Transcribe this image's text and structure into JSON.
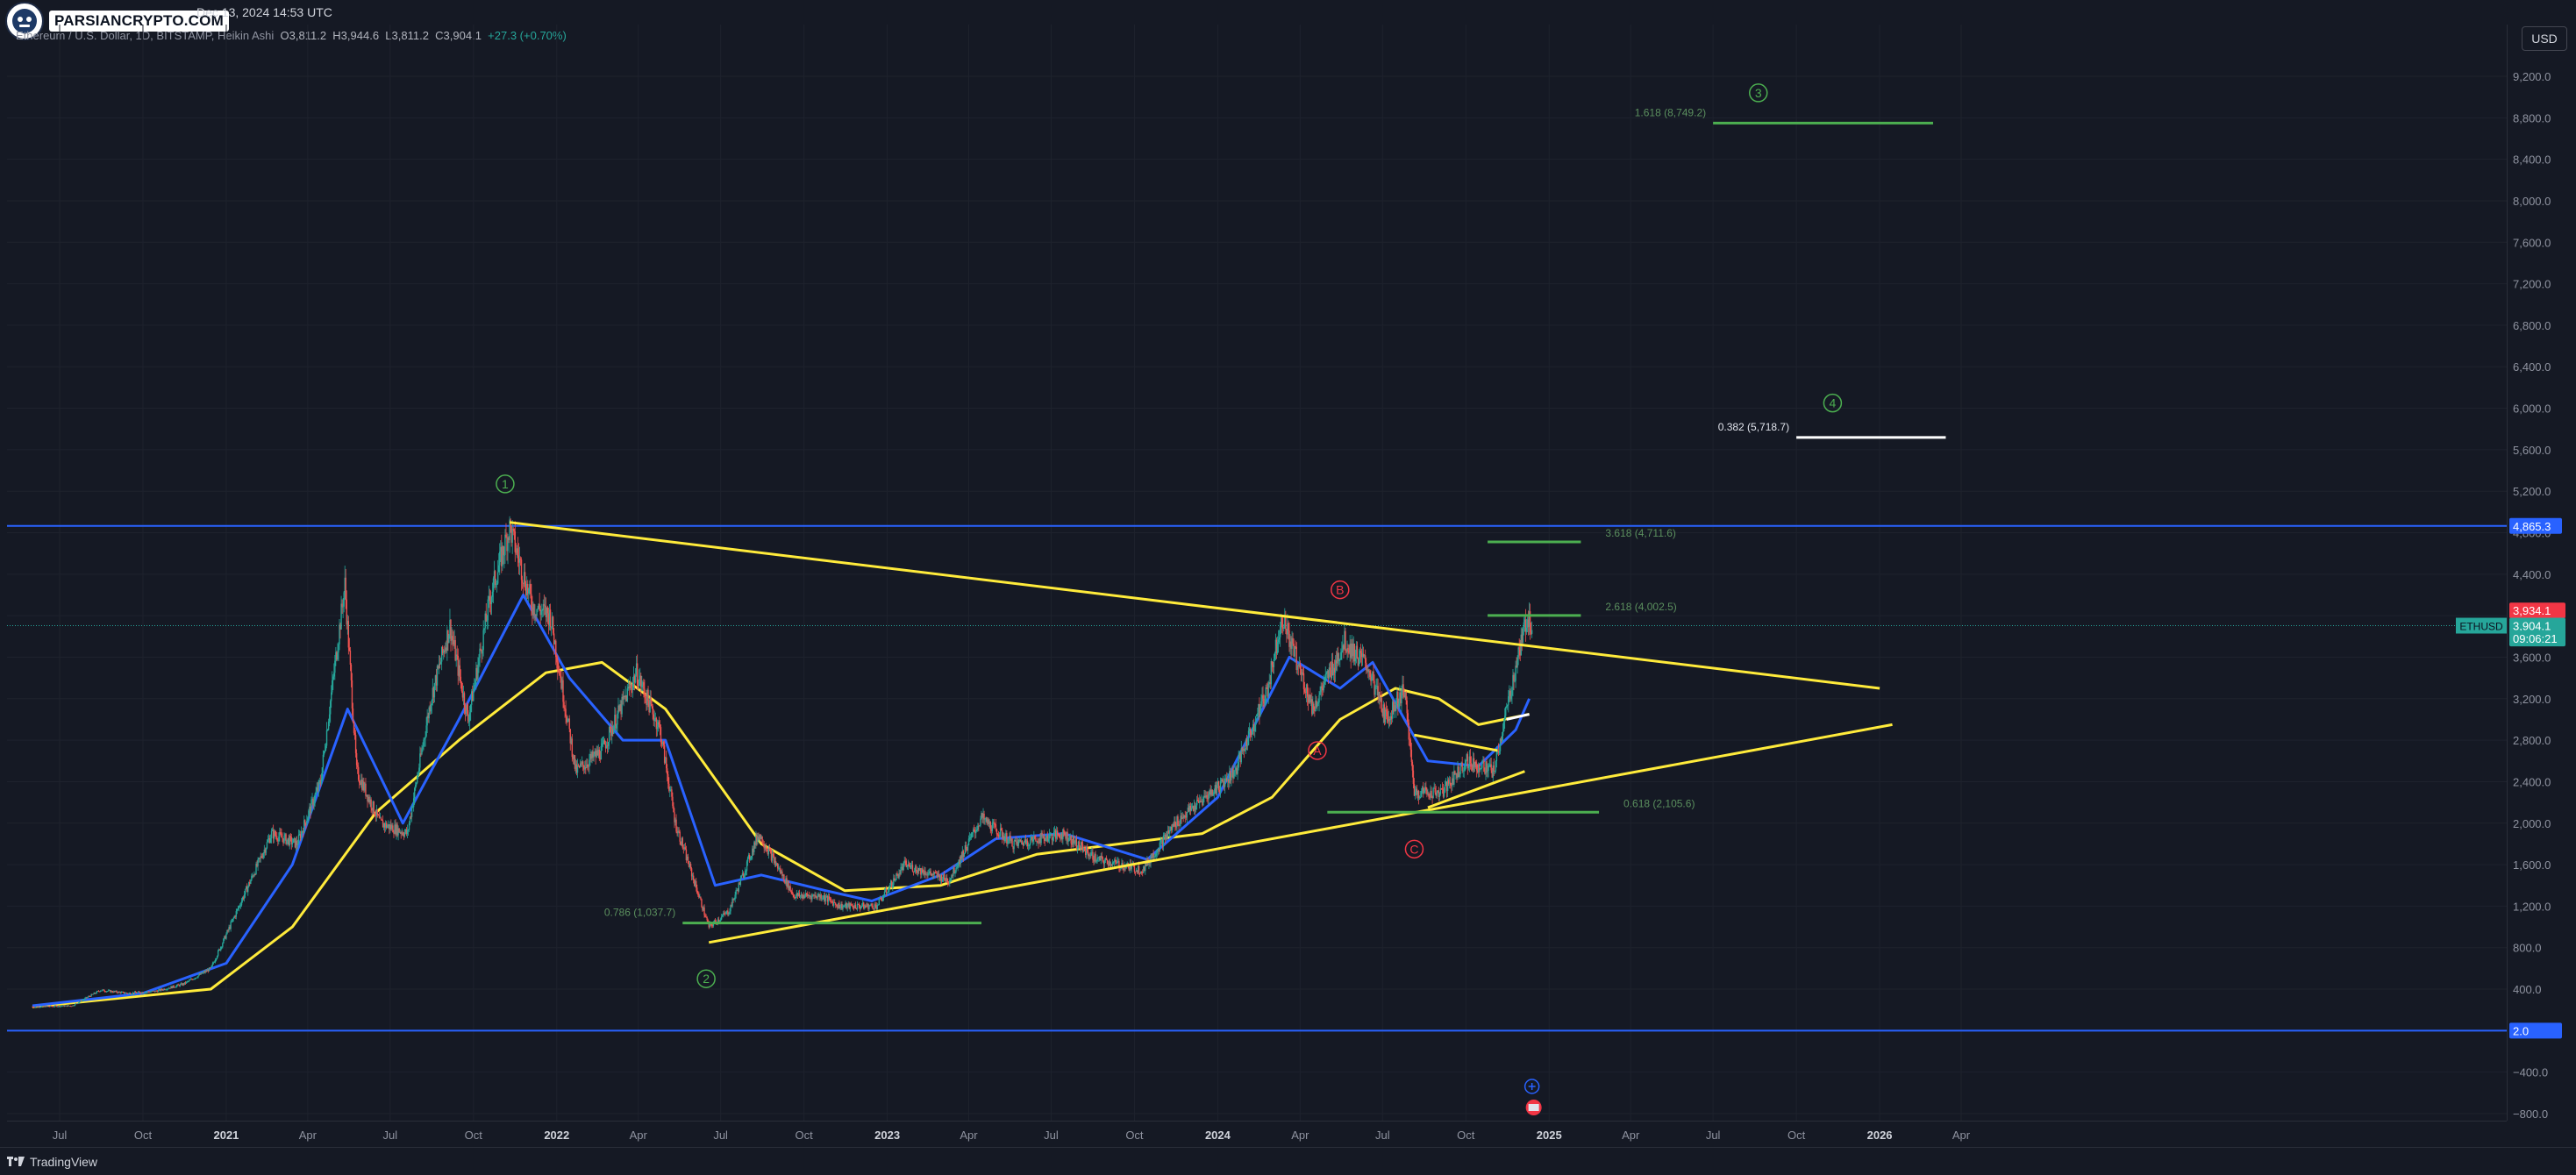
{
  "header": {
    "brand": "PARSIANCRYPTO.COM",
    "date": "Dec 13, 2024 14:53 UTC",
    "symbol_desc": "Ethereum / U.S. Dollar, 1D, BITSTAMP, Heikin Ashi",
    "ohlc": {
      "open": "O3,811.2",
      "high": "H3,944.6",
      "low": "L3,811.2",
      "close": "C3,904.1",
      "change": "+27.3 (+0.70%)"
    },
    "currency": "USD"
  },
  "footer": {
    "brand": "TradingView"
  },
  "chart_data": {
    "type": "candlestick",
    "symbol": "ETHUSD",
    "x_axis_labels": [
      "Jul",
      "Oct",
      "2021",
      "Apr",
      "Jul",
      "Oct",
      "2022",
      "Apr",
      "Jul",
      "Oct",
      "2023",
      "Apr",
      "Jul",
      "Oct",
      "2024",
      "Apr",
      "Jul",
      "Oct",
      "2025",
      "Apr",
      "Jul",
      "Oct",
      "2026",
      "Apr"
    ],
    "x_axis_dates": [
      "2020-07-01",
      "2020-10-01",
      "2021-01-01",
      "2021-04-01",
      "2021-07-01",
      "2021-10-01",
      "2022-01-01",
      "2022-04-01",
      "2022-07-01",
      "2022-10-01",
      "2023-01-01",
      "2023-04-01",
      "2023-07-01",
      "2023-10-01",
      "2024-01-01",
      "2024-04-01",
      "2024-07-01",
      "2024-10-01",
      "2025-01-01",
      "2025-04-01",
      "2025-07-01",
      "2025-10-01",
      "2026-01-01",
      "2026-04-01"
    ],
    "y_axis_labels": [
      "9,200.0",
      "8,800.0",
      "8,400.0",
      "8,000.0",
      "7,600.0",
      "7,200.0",
      "6,800.0",
      "6,400.0",
      "6,000.0",
      "5,600.0",
      "5,200.0",
      "4,800.0",
      "4,400.0",
      "4,000.0",
      "3,600.0",
      "3,200.0",
      "2,800.0",
      "2,400.0",
      "2,000.0",
      "1,600.0",
      "1,200.0",
      "800.0",
      "400.0",
      "0.0",
      "−400.0",
      "−800.0"
    ],
    "y_axis_values": [
      9200,
      8800,
      8400,
      8000,
      7600,
      7200,
      6800,
      6400,
      6000,
      5600,
      5200,
      4800,
      4400,
      4000,
      3600,
      3200,
      2800,
      2400,
      2000,
      1600,
      1200,
      800,
      400,
      0,
      -400,
      -800
    ],
    "ylim": [
      -800,
      9200
    ],
    "price_path": [
      [
        "2020-06-01",
        230
      ],
      [
        "2020-07-15",
        240
      ],
      [
        "2020-08-15",
        390
      ],
      [
        "2020-09-15",
        360
      ],
      [
        "2020-10-15",
        380
      ],
      [
        "2020-11-15",
        450
      ],
      [
        "2020-12-15",
        600
      ],
      [
        "2021-01-10",
        1100
      ],
      [
        "2021-02-20",
        1900
      ],
      [
        "2021-03-20",
        1800
      ],
      [
        "2021-04-15",
        2400
      ],
      [
        "2021-05-12",
        4300
      ],
      [
        "2021-05-25",
        2500
      ],
      [
        "2021-06-20",
        2000
      ],
      [
        "2021-07-20",
        1900
      ],
      [
        "2021-08-15",
        3200
      ],
      [
        "2021-09-05",
        3900
      ],
      [
        "2021-09-25",
        3000
      ],
      [
        "2021-10-20",
        4200
      ],
      [
        "2021-11-10",
        4850
      ],
      [
        "2021-12-05",
        4100
      ],
      [
        "2021-12-25",
        4000
      ],
      [
        "2022-01-22",
        2500
      ],
      [
        "2022-02-20",
        2700
      ],
      [
        "2022-03-30",
        3450
      ],
      [
        "2022-04-25",
        2900
      ],
      [
        "2022-05-12",
        2000
      ],
      [
        "2022-06-18",
        1000
      ],
      [
        "2022-07-10",
        1150
      ],
      [
        "2022-08-12",
        1900
      ],
      [
        "2022-09-20",
        1300
      ],
      [
        "2022-10-20",
        1300
      ],
      [
        "2022-11-10",
        1200
      ],
      [
        "2022-12-20",
        1200
      ],
      [
        "2023-01-20",
        1600
      ],
      [
        "2023-03-10",
        1450
      ],
      [
        "2023-04-15",
        2050
      ],
      [
        "2023-05-20",
        1800
      ],
      [
        "2023-07-15",
        1900
      ],
      [
        "2023-08-20",
        1650
      ],
      [
        "2023-10-10",
        1550
      ],
      [
        "2023-11-15",
        2000
      ],
      [
        "2023-12-25",
        2300
      ],
      [
        "2024-01-20",
        2500
      ],
      [
        "2024-02-25",
        3300
      ],
      [
        "2024-03-12",
        4000
      ],
      [
        "2024-04-15",
        3100
      ],
      [
        "2024-05-20",
        3750
      ],
      [
        "2024-06-15",
        3500
      ],
      [
        "2024-07-05",
        3000
      ],
      [
        "2024-07-25",
        3300
      ],
      [
        "2024-08-05",
        2300
      ],
      [
        "2024-09-06",
        2300
      ],
      [
        "2024-10-01",
        2600
      ],
      [
        "2024-11-01",
        2500
      ],
      [
        "2024-11-25",
        3500
      ],
      [
        "2024-12-08",
        4000
      ],
      [
        "2024-12-13",
        3904
      ]
    ],
    "ma_blue": [
      [
        "2020-06-01",
        240
      ],
      [
        "2020-10-01",
        360
      ],
      [
        "2021-01-01",
        650
      ],
      [
        "2021-03-15",
        1600
      ],
      [
        "2021-05-15",
        3100
      ],
      [
        "2021-07-15",
        2000
      ],
      [
        "2021-09-15",
        3000
      ],
      [
        "2021-11-25",
        4200
      ],
      [
        "2022-01-15",
        3400
      ],
      [
        "2022-03-15",
        2800
      ],
      [
        "2022-05-01",
        2800
      ],
      [
        "2022-06-25",
        1400
      ],
      [
        "2022-08-15",
        1500
      ],
      [
        "2022-10-25",
        1350
      ],
      [
        "2022-12-15",
        1250
      ],
      [
        "2023-03-01",
        1500
      ],
      [
        "2023-05-01",
        1850
      ],
      [
        "2023-07-15",
        1900
      ],
      [
        "2023-10-15",
        1650
      ],
      [
        "2024-01-01",
        2250
      ],
      [
        "2024-03-20",
        3600
      ],
      [
        "2024-05-15",
        3300
      ],
      [
        "2024-06-20",
        3550
      ],
      [
        "2024-08-20",
        2600
      ],
      [
        "2024-10-15",
        2550
      ],
      [
        "2024-11-25",
        2900
      ],
      [
        "2024-12-10",
        3200
      ]
    ],
    "ma_yellow": [
      [
        "2020-06-01",
        230
      ],
      [
        "2020-12-15",
        400
      ],
      [
        "2021-03-15",
        1000
      ],
      [
        "2021-06-15",
        2100
      ],
      [
        "2021-09-15",
        2800
      ],
      [
        "2021-12-20",
        3450
      ],
      [
        "2022-02-20",
        3550
      ],
      [
        "2022-05-01",
        3100
      ],
      [
        "2022-08-15",
        1800
      ],
      [
        "2022-11-15",
        1350
      ],
      [
        "2023-03-01",
        1400
      ],
      [
        "2023-06-15",
        1700
      ],
      [
        "2023-09-15",
        1800
      ],
      [
        "2023-12-15",
        1900
      ],
      [
        "2024-03-01",
        2250
      ],
      [
        "2024-05-15",
        3000
      ],
      [
        "2024-07-15",
        3300
      ],
      [
        "2024-09-01",
        3200
      ],
      [
        "2024-10-15",
        2950
      ],
      [
        "2024-12-10",
        3050
      ]
    ],
    "trendlines": [
      {
        "name": "upper-trendline",
        "color": "#ffeb3b",
        "points": [
          [
            "2021-11-10",
            4900
          ],
          [
            "2026-01-01",
            3300
          ]
        ]
      },
      {
        "name": "lower-trendline",
        "color": "#ffeb3b",
        "points": [
          [
            "2022-06-18",
            850
          ],
          [
            "2026-01-15",
            2950
          ]
        ]
      },
      {
        "name": "channel-top",
        "color": "#ffeb3b",
        "points": [
          [
            "2024-08-05",
            2850
          ],
          [
            "2024-11-05",
            2700
          ]
        ]
      },
      {
        "name": "channel-bottom",
        "color": "#ffeb3b",
        "points": [
          [
            "2024-08-20",
            2150
          ],
          [
            "2024-12-05",
            2500
          ]
        ]
      },
      {
        "name": "channel-mid",
        "color": "#ffffff",
        "points": [
          [
            "2024-11-15",
            3000
          ],
          [
            "2024-12-10",
            3050
          ]
        ]
      }
    ],
    "hlines": [
      {
        "name": "resistance-line",
        "color": "#2962ff",
        "value": 4865.3,
        "label": "4,865.3"
      },
      {
        "name": "zero-line",
        "color": "#2962ff",
        "value": 0,
        "label": "2.0"
      },
      {
        "name": "current-price-line",
        "color": "#26a69a",
        "value": 3904.1
      }
    ],
    "fib_levels": [
      {
        "name": "fib-1618",
        "label": "1.618 (8,749.2)",
        "value": 8749.2,
        "color": "#4caf50",
        "x_start": "2025-07-01",
        "x_end": "2026-03-01",
        "label_color": "#5b8f5e"
      },
      {
        "name": "fib-0382",
        "label": "0.382 (5,718.7)",
        "value": 5718.7,
        "color": "#ffffff",
        "x_start": "2025-10-01",
        "x_end": "2026-03-15",
        "label_color": "#e0e3eb"
      },
      {
        "name": "fib-3618",
        "label": "3.618 (4,711.6)",
        "value": 4711.6,
        "color": "#4caf50",
        "x_start": "2024-10-25",
        "x_end": "2025-02-05",
        "label_color": "#5b8f5e"
      },
      {
        "name": "fib-2618",
        "label": "2.618 (4,002.5)",
        "value": 4002.5,
        "color": "#4caf50",
        "x_start": "2024-10-25",
        "x_end": "2025-02-05",
        "label_color": "#5b8f5e"
      },
      {
        "name": "fib-0618",
        "label": "0.618 (2,105.6)",
        "value": 2105.6,
        "color": "#4caf50",
        "x_start": "2024-05-01",
        "x_end": "2025-02-25",
        "label_color": "#5b8f5e"
      },
      {
        "name": "fib-0786",
        "label": "0.786 (1,037.7)",
        "value": 1037.7,
        "color": "#4caf50",
        "x_start": "2022-05-20",
        "x_end": "2023-04-15",
        "label_color": "#5b8f5e"
      }
    ],
    "wave_labels": [
      {
        "name": "wave-1-label",
        "text": "1",
        "color": "#4caf50",
        "date": "2021-11-05",
        "value": 5270
      },
      {
        "name": "wave-2-label",
        "text": "2",
        "color": "#4caf50",
        "date": "2022-06-15",
        "value": 500
      },
      {
        "name": "wave-3-label",
        "text": "3",
        "color": "#4caf50",
        "date": "2025-08-20",
        "value": 9040
      },
      {
        "name": "wave-4-label",
        "text": "4",
        "color": "#4caf50",
        "date": "2025-11-10",
        "value": 6050
      },
      {
        "name": "wave-a-label",
        "text": "A",
        "color": "#f23645",
        "date": "2024-04-20",
        "value": 2700
      },
      {
        "name": "wave-b-label",
        "text": "B",
        "color": "#f23645",
        "date": "2024-05-15",
        "value": 4250
      },
      {
        "name": "wave-c-label",
        "text": "C",
        "color": "#f23645",
        "date": "2024-08-05",
        "value": 1750
      }
    ],
    "price_tags": [
      {
        "name": "alert-price-tag",
        "text": "3,934.1",
        "color": "#f23645",
        "value": 4050
      },
      {
        "name": "last-price-tag",
        "text": "3,904.1",
        "color": "#26a69a",
        "value": 3904.1
      },
      {
        "name": "countdown-tag",
        "text": "09:06:21",
        "color": "#26a69a",
        "value": 3780
      }
    ],
    "symbol_tag": {
      "text": "ETHUSD",
      "color": "#26a69a"
    },
    "grid": true
  }
}
